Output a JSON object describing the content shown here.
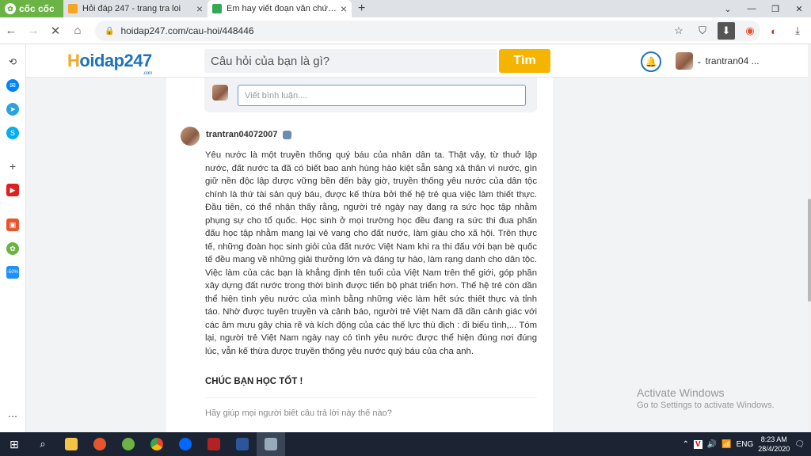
{
  "browser": {
    "brand": "cốc cốc",
    "tabs": [
      {
        "title": "Hỏi đáp 247 - trang tra loi",
        "active": false,
        "favicon_color": "#f5a623"
      },
      {
        "title": "Em hay viết đoạn văn chứng minh",
        "active": true,
        "favicon_color": "#34a853"
      }
    ],
    "url": "hoidap247.com/cau-hoi/448446"
  },
  "site": {
    "logo_h": "H",
    "logo_rest": "oidap247",
    "logo_com": ".com",
    "search_placeholder": "Câu hỏi của bạn là gì?",
    "search_button": "Tìm",
    "username": "trantran04 ..."
  },
  "comment": {
    "placeholder": "Viết bình luận...."
  },
  "answer": {
    "author": "trantran04072007",
    "text": "Yêu nước là một truyền thống quý báu của nhân dân ta. Thật vậy, từ thuở lập nước, đất nước ta đã có biết bao anh hùng hào kiệt sẵn sàng xả thân vì nước, gìn giữ nền độc lập được vững bền đến bây giờ, truyền thống yêu nước của dân tộc chính là thứ tài sản quý báu, được kế thừa bởi thế hệ trẻ qua việc làm thiết thực. Đầu tiên, có thể nhận thấy rằng, người trẻ ngày nay đang ra sức học tập nhằm phụng sự cho tổ quốc. Học sinh ở mọi trường học đều đang ra sức thi đua phấn đấu học tập nhằm mang lại vẻ vang cho đất nước, làm giàu cho xã hội. Trên thực tế, những đoàn học sinh giỏi của đất nước Việt Nam khi ra thi đấu với bạn bè quốc tế đều mang về những giải thưởng lớn và đáng tự hào, làm rạng danh cho dân tộc. Việc làm của các bạn là khẳng định tên tuổi của Việt Nam trên thế giới, góp phần xây dựng đất nước trong thời bình được tiến bộ phát triển hơn. Thế hệ trẻ còn dần thể hiện tình yêu nước của mình bằng những việc làm hết sức thiết thực và tỉnh táo. Nhờ được tuyên truyền và cảnh báo, người trẻ Việt Nam đã dần cảnh giác với các âm mưu gây chia rẽ và kích động của các thế lực thù địch : đi biểu tình,... Tóm lại, người trẻ Việt Nam ngày nay có tình yêu nước được thể hiện đúng nơi đúng lúc, vẫn kế thừa được truyền thống yêu nước quý báu của cha anh.",
    "closing": "CHÚC BẠN HỌC TỐT !",
    "feedback_prompt": "Hãy giúp mọi người biết câu trả lời này thế nào?"
  },
  "watermark": {
    "line1": "Activate Windows",
    "line2": "Go to Settings to activate Windows."
  },
  "taskbar": {
    "lang": "ENG",
    "time": "8:23 AM",
    "date": "28/4/2020"
  },
  "colors": {
    "brand_green": "#6ab344",
    "accent_blue": "#1e73be",
    "search_yellow": "#f4b400",
    "taskbar": "#1c2433"
  }
}
